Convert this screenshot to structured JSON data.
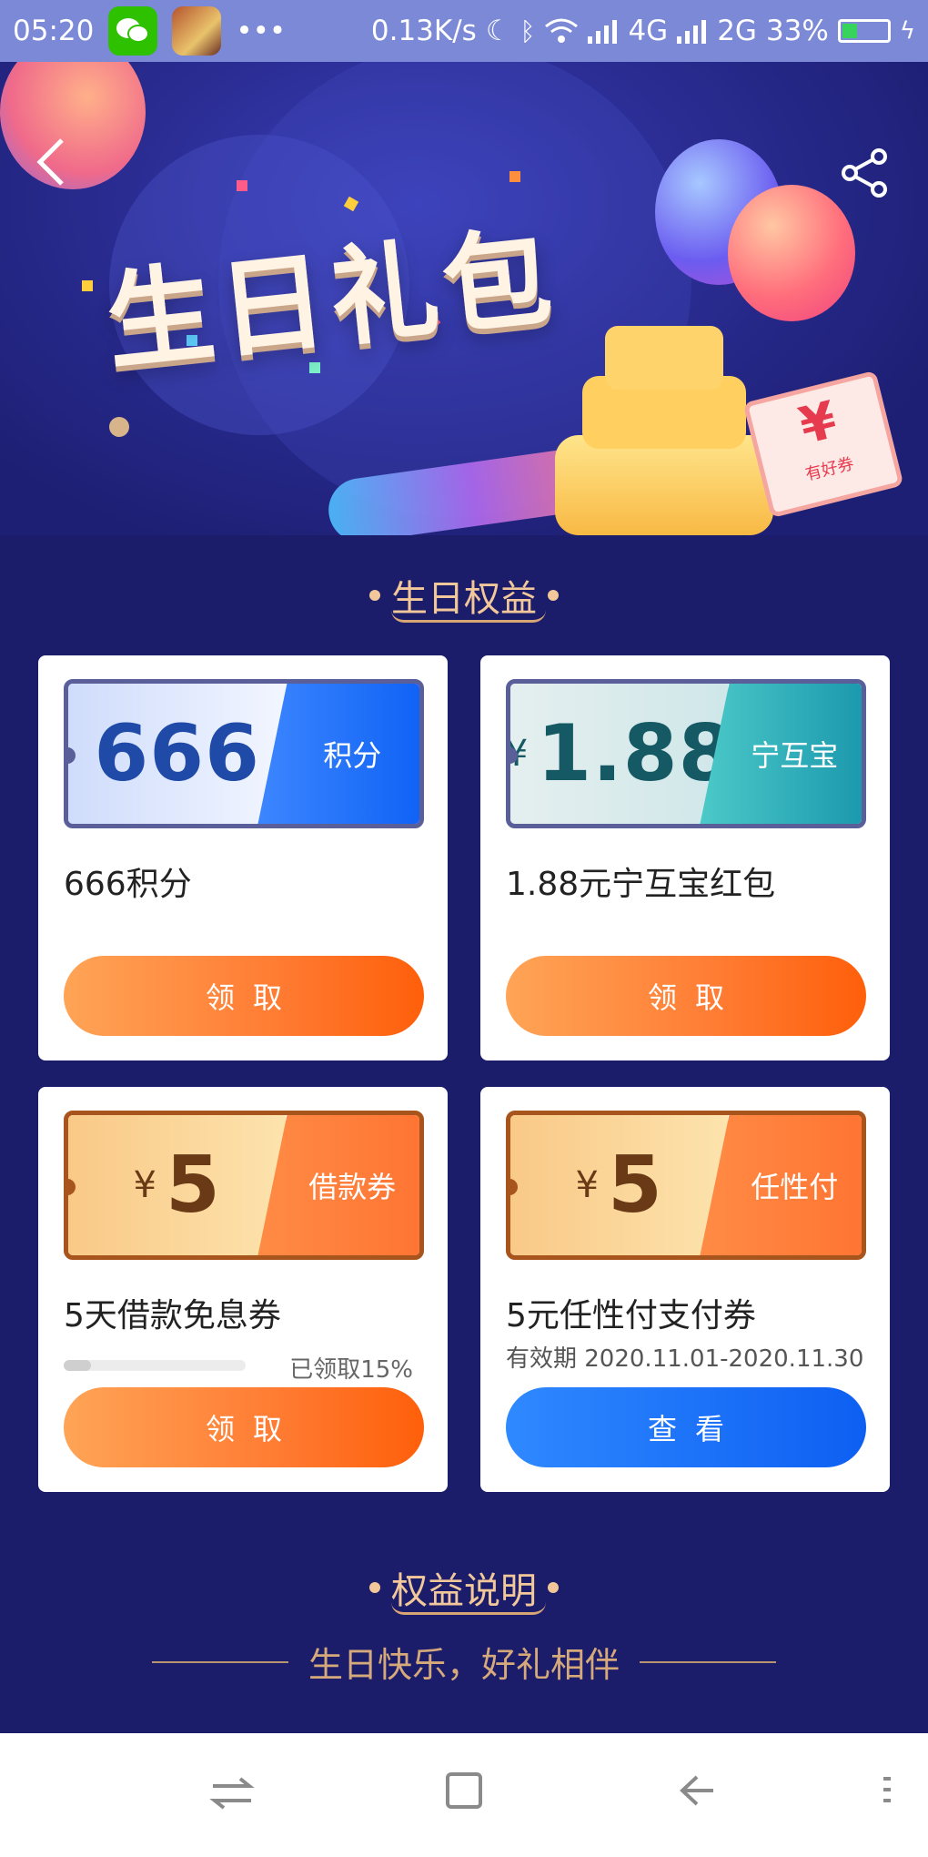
{
  "status_bar": {
    "time": "05:20",
    "more": "•••",
    "speed": "0.13K/s",
    "net1": "4G",
    "net2": "2G",
    "battery": "33%"
  },
  "hero": {
    "title": "生日礼包",
    "ticket_symbol": "¥",
    "ticket_text": "有好券"
  },
  "section_benefits": {
    "title": "生日权益"
  },
  "cards": [
    {
      "value": "666",
      "tag": "积分",
      "title": "666积分",
      "button": "领取"
    },
    {
      "currency": "¥",
      "value": "1.88",
      "tag": "宁互宝",
      "title": "1.88元宁互宝红包",
      "button": "领取"
    },
    {
      "currency": "¥",
      "value": "5",
      "tag": "借款券",
      "title": "5天借款免息券",
      "progress_text": "已领取15%",
      "progress": 0.15,
      "button": "领取"
    },
    {
      "currency": "¥",
      "value": "5",
      "tag": "任性付",
      "title": "5元任性付支付券",
      "validity": "有效期 2020.11.01-2020.11.30",
      "button": "查看"
    }
  ],
  "section_explain": {
    "title": "权益说明",
    "subtitle": "生日快乐，好礼相伴"
  },
  "nav": {
    "menu": "⇄",
    "home": "□",
    "back": "<",
    "more": "⋮"
  },
  "colors": {
    "background": "#1b1d6b",
    "accent_orange": "#ff7b32",
    "accent_blue": "#0d5ff2",
    "heading_gold": "#f2c89a"
  }
}
